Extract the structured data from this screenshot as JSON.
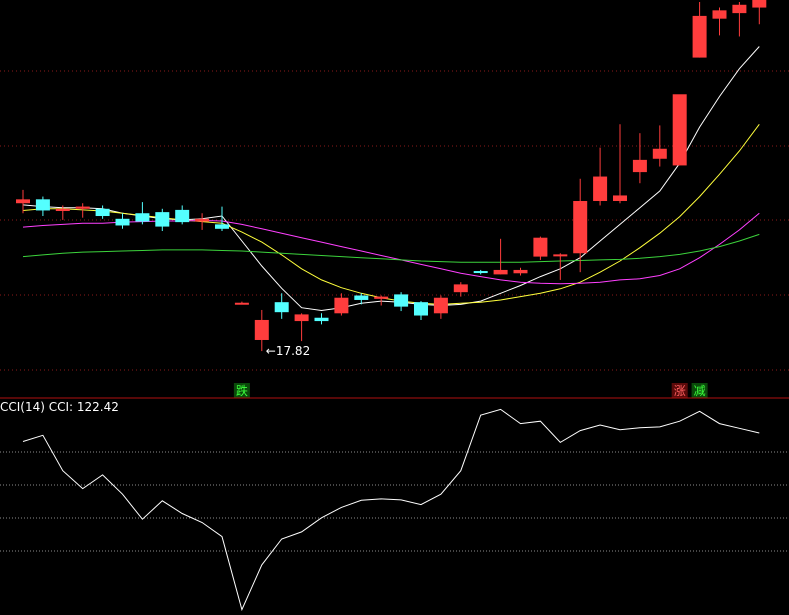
{
  "colors": {
    "up": "#ff3d3d",
    "down": "#54ffff",
    "ma_white": "#ffffff",
    "ma_yellow": "#ffff3c",
    "ma_magenta": "#ff40ff",
    "ma_green": "#3cd33c",
    "grid_price": "#8b1a1a",
    "grid_cci": "#8b8b8b",
    "divider": "#b01010",
    "signal_bg_buy": "#0a4a0a",
    "signal_bg_sell": "#5a0a0a",
    "signal_bg_reduce": "#0a4a0a"
  },
  "price_panel": {
    "low_label": "17.82",
    "signals": [
      {
        "text": "跌",
        "kind": "buy",
        "index": 11
      },
      {
        "text": "涨",
        "kind": "sell",
        "index": 33
      },
      {
        "text": "减",
        "kind": "reduce",
        "index": 34
      }
    ]
  },
  "cci_panel": {
    "label": "CCI(14) CCI: 122.42"
  },
  "chart_data": [
    {
      "type": "candlestick",
      "grid": true,
      "ylim": [
        17.3,
        24.1
      ],
      "candles": [
        {
          "o": 20.48,
          "h": 20.72,
          "l": 20.3,
          "c": 20.55
        },
        {
          "o": 20.55,
          "h": 20.6,
          "l": 20.25,
          "c": 20.35
        },
        {
          "o": 20.34,
          "h": 20.44,
          "l": 20.18,
          "c": 20.38
        },
        {
          "o": 20.38,
          "h": 20.48,
          "l": 20.22,
          "c": 20.42
        },
        {
          "o": 20.38,
          "h": 20.44,
          "l": 20.2,
          "c": 20.25
        },
        {
          "o": 20.2,
          "h": 20.3,
          "l": 20.02,
          "c": 20.08
        },
        {
          "o": 20.3,
          "h": 20.5,
          "l": 20.1,
          "c": 20.15
        },
        {
          "o": 20.32,
          "h": 20.38,
          "l": 19.98,
          "c": 20.06
        },
        {
          "o": 20.36,
          "h": 20.44,
          "l": 20.1,
          "c": 20.14
        },
        {
          "o": 20.15,
          "h": 20.3,
          "l": 20.0,
          "c": 20.2
        },
        {
          "o": 20.1,
          "h": 20.42,
          "l": 19.98,
          "c": 20.02
        },
        {
          "o": 18.68,
          "h": 18.71,
          "l": 18.68,
          "c": 18.69
        },
        {
          "o": 18.02,
          "h": 18.56,
          "l": 17.82,
          "c": 18.38
        },
        {
          "o": 18.7,
          "h": 18.86,
          "l": 18.4,
          "c": 18.52
        },
        {
          "o": 18.36,
          "h": 18.5,
          "l": 18.0,
          "c": 18.48
        },
        {
          "o": 18.42,
          "h": 18.5,
          "l": 18.3,
          "c": 18.36
        },
        {
          "o": 18.5,
          "h": 18.86,
          "l": 18.46,
          "c": 18.78
        },
        {
          "o": 18.82,
          "h": 18.86,
          "l": 18.66,
          "c": 18.74
        },
        {
          "o": 18.76,
          "h": 18.82,
          "l": 18.64,
          "c": 18.8
        },
        {
          "o": 18.84,
          "h": 18.88,
          "l": 18.54,
          "c": 18.62
        },
        {
          "o": 18.7,
          "h": 18.72,
          "l": 18.38,
          "c": 18.46
        },
        {
          "o": 18.5,
          "h": 18.82,
          "l": 18.4,
          "c": 18.78
        },
        {
          "o": 18.88,
          "h": 19.06,
          "l": 18.8,
          "c": 19.02
        },
        {
          "o": 19.26,
          "h": 19.28,
          "l": 19.2,
          "c": 19.24
        },
        {
          "o": 19.2,
          "h": 19.84,
          "l": 19.2,
          "c": 19.28
        },
        {
          "o": 19.22,
          "h": 19.32,
          "l": 19.18,
          "c": 19.28
        },
        {
          "o": 19.52,
          "h": 19.88,
          "l": 19.46,
          "c": 19.86
        },
        {
          "o": 19.54,
          "h": 19.58,
          "l": 19.1,
          "c": 19.56
        },
        {
          "o": 19.58,
          "h": 20.92,
          "l": 19.24,
          "c": 20.52
        },
        {
          "o": 20.52,
          "h": 21.48,
          "l": 20.44,
          "c": 20.96
        },
        {
          "o": 20.52,
          "h": 21.9,
          "l": 20.48,
          "c": 20.62
        },
        {
          "o": 21.04,
          "h": 21.74,
          "l": 20.84,
          "c": 21.26
        },
        {
          "o": 21.28,
          "h": 21.88,
          "l": 21.14,
          "c": 21.46
        },
        {
          "o": 21.16,
          "h": 22.2,
          "l": 21.16,
          "c": 22.44
        },
        {
          "o": 23.1,
          "h": 24.1,
          "l": 23.1,
          "c": 23.85
        },
        {
          "o": 23.8,
          "h": 24.0,
          "l": 23.5,
          "c": 23.95
        },
        {
          "o": 23.9,
          "h": 24.1,
          "l": 23.48,
          "c": 24.05
        },
        {
          "o": 24.0,
          "h": 24.1,
          "l": 23.7,
          "c": 24.15
        }
      ],
      "ma": [
        {
          "color_key": "ma_white",
          "values": [
            20.45,
            20.42,
            20.4,
            20.4,
            20.38,
            20.3,
            20.25,
            20.2,
            20.18,
            20.2,
            20.25,
            19.8,
            19.35,
            18.95,
            18.6,
            18.55,
            18.6,
            18.68,
            18.72,
            18.7,
            18.66,
            18.64,
            18.66,
            18.72,
            18.86,
            19.0,
            19.16,
            19.3,
            19.5,
            19.8,
            20.1,
            20.4,
            20.7,
            21.2,
            21.85,
            22.4,
            22.9,
            23.3
          ]
        },
        {
          "color_key": "ma_yellow",
          "values": [
            20.35,
            20.38,
            20.38,
            20.36,
            20.34,
            20.3,
            20.26,
            20.22,
            20.18,
            20.15,
            20.12,
            19.96,
            19.78,
            19.55,
            19.3,
            19.1,
            18.96,
            18.86,
            18.78,
            18.72,
            18.68,
            18.66,
            18.68,
            18.7,
            18.74,
            18.8,
            18.86,
            18.94,
            19.06,
            19.24,
            19.44,
            19.68,
            19.94,
            20.24,
            20.6,
            21.0,
            21.42,
            21.9
          ]
        },
        {
          "color_key": "ma_magenta",
          "values": [
            20.05,
            20.08,
            20.1,
            20.12,
            20.12,
            20.14,
            20.15,
            20.16,
            20.16,
            20.17,
            20.16,
            20.1,
            20.02,
            19.94,
            19.86,
            19.78,
            19.7,
            19.62,
            19.54,
            19.46,
            19.38,
            19.3,
            19.22,
            19.16,
            19.1,
            19.06,
            19.04,
            19.03,
            19.04,
            19.06,
            19.1,
            19.12,
            19.18,
            19.3,
            19.5,
            19.74,
            20.0,
            20.3
          ]
        },
        {
          "color_key": "ma_green",
          "values": [
            19.52,
            19.55,
            19.58,
            19.6,
            19.61,
            19.62,
            19.63,
            19.64,
            19.64,
            19.64,
            19.63,
            19.62,
            19.6,
            19.58,
            19.56,
            19.54,
            19.52,
            19.5,
            19.48,
            19.46,
            19.44,
            19.43,
            19.42,
            19.42,
            19.42,
            19.42,
            19.43,
            19.44,
            19.45,
            19.46,
            19.47,
            19.49,
            19.52,
            19.56,
            19.62,
            19.7,
            19.8,
            19.92
          ]
        }
      ]
    },
    {
      "type": "line",
      "grid": true,
      "ylim": [
        -300,
        150
      ],
      "series": [
        {
          "values": [
            62,
            75,
            0,
            -38,
            -9,
            -50,
            -103,
            -64,
            -91,
            -110,
            -140,
            -295,
            -200,
            -145,
            -130,
            -100,
            -78,
            -63,
            -60,
            -62,
            -72,
            -50,
            0,
            118,
            130,
            100,
            105,
            60,
            85,
            97,
            87,
            91,
            93,
            105,
            126,
            100,
            90,
            80
          ]
        }
      ]
    }
  ]
}
